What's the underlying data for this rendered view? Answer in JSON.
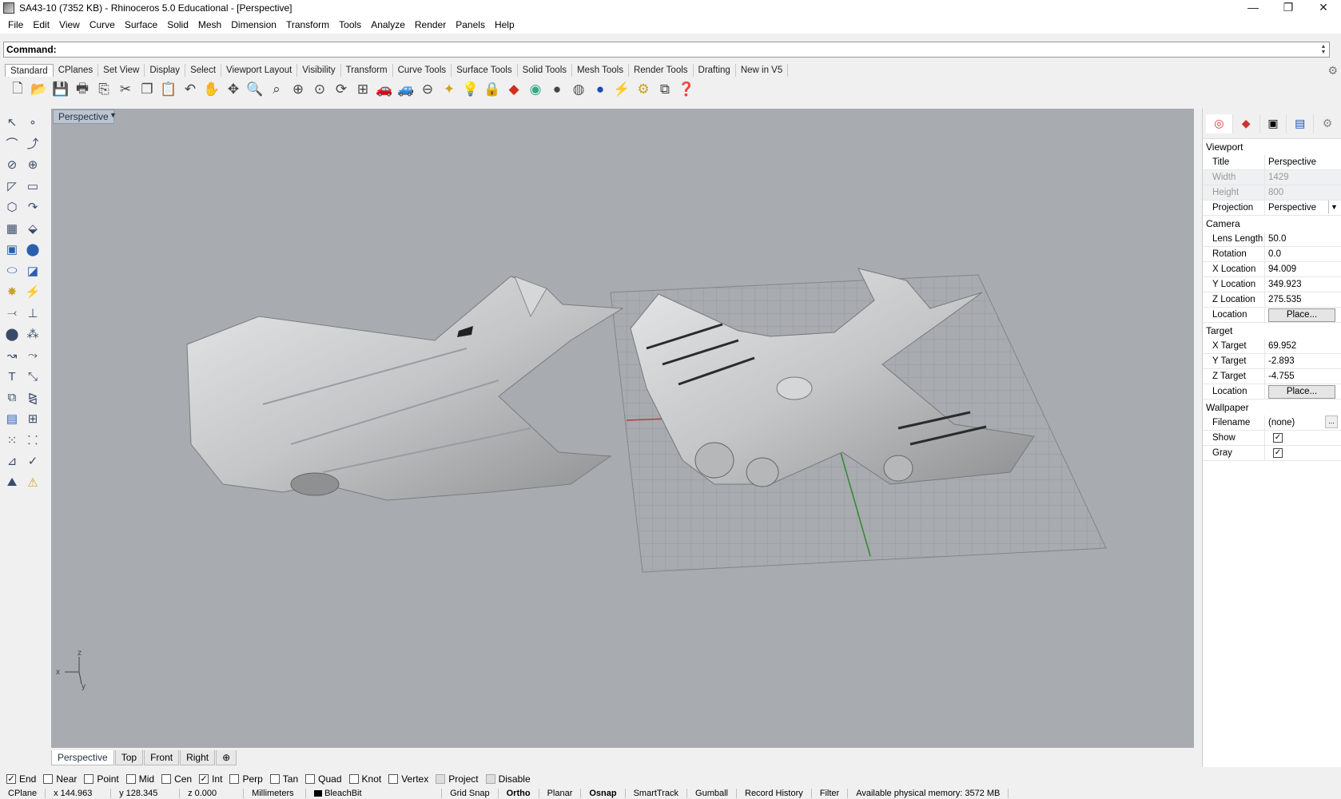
{
  "window": {
    "title": "SA43-10 (7352 KB) - Rhinoceros 5.0 Educational - [Perspective]",
    "minimize": "—",
    "restore": "❐",
    "close": "✕"
  },
  "menu": [
    "File",
    "Edit",
    "View",
    "Curve",
    "Surface",
    "Solid",
    "Mesh",
    "Dimension",
    "Transform",
    "Tools",
    "Analyze",
    "Render",
    "Panels",
    "Help"
  ],
  "command": {
    "label": "Command:",
    "value": ""
  },
  "toolbar_tabs": [
    "Standard",
    "CPlanes",
    "Set View",
    "Display",
    "Select",
    "Viewport Layout",
    "Visibility",
    "Transform",
    "Curve Tools",
    "Surface Tools",
    "Solid Tools",
    "Mesh Tools",
    "Render Tools",
    "Drafting",
    "New in V5"
  ],
  "toolbar_icons": [
    "new-file-icon",
    "open-icon",
    "save-icon",
    "print-icon",
    "import-icon",
    "cut-icon",
    "copy-icon",
    "paste-icon",
    "undo-icon",
    "pan-icon",
    "rotate-icon",
    "zoom-icon",
    "zoom-window-icon",
    "zoom-extents-icon",
    "zoom-selected-icon",
    "four-views-icon",
    "car-icon",
    "car-outline-icon",
    "cplane-icon",
    "grid-icon",
    "light-icon",
    "lock-icon",
    "material-icon",
    "color-wheel-icon",
    "shade-icon",
    "render-icon",
    "environment-icon",
    "options-icon",
    "tools-icon",
    "layout-icon",
    "help-icon"
  ],
  "viewport": {
    "name": "Perspective",
    "axis_x": "x",
    "axis_y": "y",
    "axis_z": "z"
  },
  "view_tabs": [
    "Perspective",
    "Top",
    "Front",
    "Right"
  ],
  "osnaps": [
    {
      "label": "End",
      "checked": true
    },
    {
      "label": "Near",
      "checked": false
    },
    {
      "label": "Point",
      "checked": false
    },
    {
      "label": "Mid",
      "checked": false
    },
    {
      "label": "Cen",
      "checked": false
    },
    {
      "label": "Int",
      "checked": true
    },
    {
      "label": "Perp",
      "checked": false
    },
    {
      "label": "Tan",
      "checked": false
    },
    {
      "label": "Quad",
      "checked": false
    },
    {
      "label": "Knot",
      "checked": false
    },
    {
      "label": "Vertex",
      "checked": false
    },
    {
      "label": "Project",
      "checked": false
    },
    {
      "label": "Disable",
      "checked": false
    }
  ],
  "status": {
    "cplane": "CPlane",
    "x": "x 144.963",
    "y": "y 128.345",
    "z": "z 0.000",
    "units": "Millimeters",
    "layer": "BleachBit",
    "grid_snap": "Grid Snap",
    "ortho": "Ortho",
    "planar": "Planar",
    "osnap": "Osnap",
    "smarttrack": "SmartTrack",
    "gumball": "Gumball",
    "record_history": "Record History",
    "filter": "Filter",
    "memory": "Available physical memory: 3572 MB"
  },
  "properties": {
    "viewport_header": "Viewport",
    "title_k": "Title",
    "title_v": "Perspective",
    "width_k": "Width",
    "width_v": "1429",
    "height_k": "Height",
    "height_v": "800",
    "projection_k": "Projection",
    "projection_v": "Perspective",
    "camera_header": "Camera",
    "lens_k": "Lens Length",
    "lens_v": "50.0",
    "rotation_k": "Rotation",
    "rotation_v": "0.0",
    "xloc_k": "X Location",
    "xloc_v": "94.009",
    "yloc_k": "Y Location",
    "yloc_v": "349.923",
    "zloc_k": "Z Location",
    "zloc_v": "275.535",
    "loc_k": "Location",
    "place": "Place...",
    "target_header": "Target",
    "xt_k": "X Target",
    "xt_v": "69.952",
    "yt_k": "Y Target",
    "yt_v": "-2.893",
    "zt_k": "Z Target",
    "zt_v": "-4.755",
    "tloc_k": "Location",
    "wallpaper_header": "Wallpaper",
    "filename_k": "Filename",
    "filename_v": "(none)",
    "browse": "...",
    "show_k": "Show",
    "gray_k": "Gray"
  }
}
